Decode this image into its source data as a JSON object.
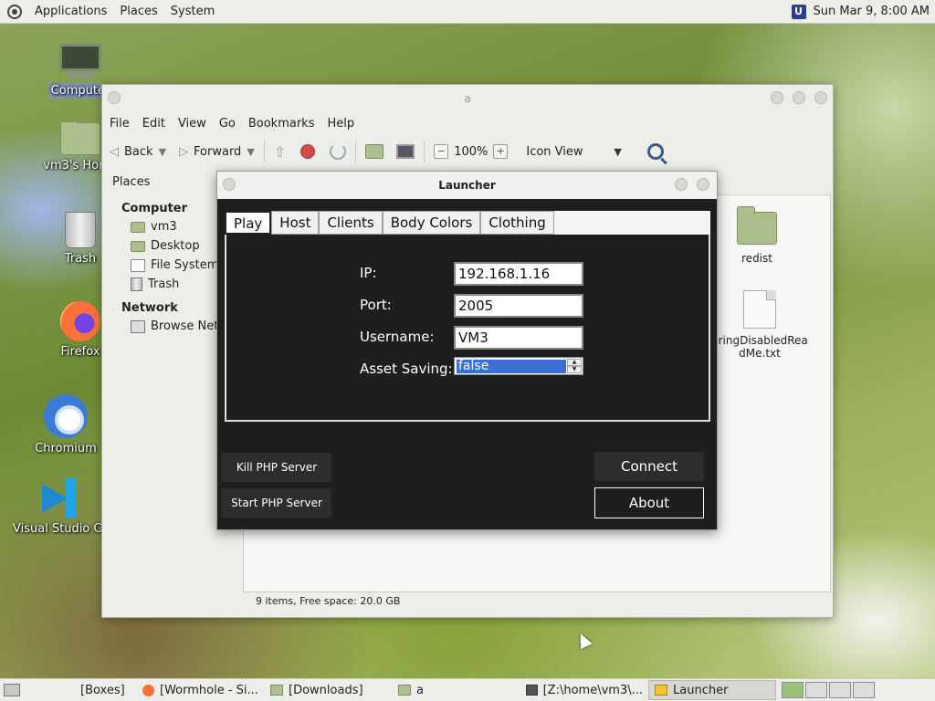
{
  "top_panel": {
    "menus": [
      "Applications",
      "Places",
      "System"
    ],
    "datetime": "Sun Mar 9,  8:00 AM"
  },
  "desktop": {
    "icons": [
      {
        "label": "Computer",
        "icon": "computer-icon"
      },
      {
        "label": "vm3's Home",
        "icon": "home-folder-icon"
      },
      {
        "label": "Trash",
        "icon": "trash-icon"
      },
      {
        "label": "Firefox",
        "icon": "firefox-icon"
      },
      {
        "label": "Chromium",
        "icon": "chromium-icon"
      },
      {
        "label": "Visual Studio Code",
        "icon": "vscode-icon"
      }
    ]
  },
  "file_manager": {
    "title": "a",
    "menu": [
      "File",
      "Edit",
      "View",
      "Go",
      "Bookmarks",
      "Help"
    ],
    "toolbar": {
      "back": "Back",
      "forward": "Forward",
      "zoom": "100%",
      "view_mode": "Icon View"
    },
    "sidebar": {
      "selector": "Places",
      "computer_heading": "Computer",
      "computer_items": [
        "vm3",
        "Desktop",
        "File System",
        "Trash"
      ],
      "network_heading": "Network",
      "network_items": [
        "Browse Net..."
      ]
    },
    "files": [
      {
        "name": "redist",
        "type": "folder"
      },
      {
        "name": "eringDisabledReadMe.txt",
        "type": "text"
      }
    ],
    "status": "9 items, Free space: 20.0 GB"
  },
  "launcher": {
    "title": "Launcher",
    "tabs": [
      "Play",
      "Host",
      "Clients",
      "Body Colors",
      "Clothing"
    ],
    "active_tab": "Play",
    "fields": {
      "ip_label": "IP:",
      "ip_value": "192.168.1.16",
      "port_label": "Port:",
      "port_value": "2005",
      "username_label": "Username:",
      "username_value": "VM3",
      "asset_label": "Asset Saving:",
      "asset_value": "false"
    },
    "buttons": {
      "kill_php": "Kill PHP Server",
      "start_php": "Start PHP Server",
      "connect": "Connect",
      "about": "About"
    }
  },
  "taskbar": {
    "tasks": [
      {
        "label": "[Boxes]",
        "icon": "none"
      },
      {
        "label": "[Wormhole - Si...",
        "icon": "firefox-icon"
      },
      {
        "label": "[Downloads]",
        "icon": "folder-icon"
      },
      {
        "label": "a",
        "icon": "folder-icon"
      },
      {
        "label": "[Z:\\home\\vm3\\...",
        "icon": "terminal-icon"
      },
      {
        "label": "Launcher",
        "icon": "launcher-icon"
      }
    ],
    "active_task": "Launcher"
  }
}
